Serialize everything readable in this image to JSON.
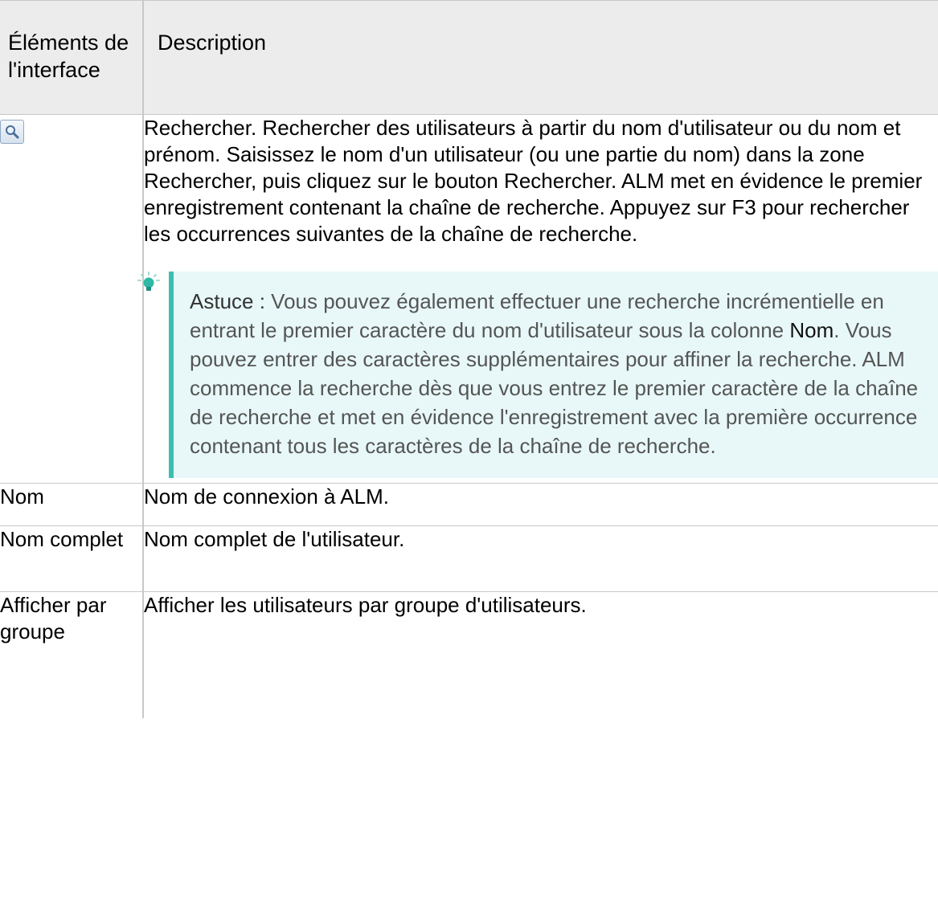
{
  "table": {
    "header": {
      "col1": "Éléments de l'interface",
      "col2": "Description"
    },
    "search_row": {
      "icon": "magnifier-icon",
      "term": "Rechercher.",
      "text_1": " Rechercher des utilisateurs à partir du nom d'utilisateur ou du nom et prénom. Saisissez le nom d'un utilisateur (ou une partie du nom) dans la zone ",
      "kw_1": "Rechercher",
      "text_2": ", puis cliquez sur le bouton ",
      "kw_2": "Rechercher",
      "text_3": ". ALM met en évidence le premier enregistrement contenant la chaîne de recherche. Appuyez sur F3 pour rechercher les occurrences suivantes de la chaîne de recherche."
    },
    "tip": {
      "icon": "lightbulb-icon",
      "label": "Astuce :",
      "text_1": " Vous pouvez également effectuer une recherche incrémentielle en entrant le premier caractère du nom d'utilisateur sous la colonne ",
      "kw": "Nom",
      "text_2": ". Vous pouvez entrer des caractères supplémentaires pour affiner la recherche. ALM commence la recherche dès que vous entrez le premier caractère de la chaîne de recherche et met en évidence l'enregistrement avec la première occurrence contenant tous les caractères de la chaîne de recherche."
    },
    "rows": [
      {
        "label": "Nom",
        "description": "Nom de connexion à ALM."
      },
      {
        "label": "Nom complet",
        "description": "Nom complet de l'utilisateur."
      },
      {
        "label": "Afficher par groupe",
        "description": "Afficher les utilisateurs par groupe d'utilisateurs."
      }
    ]
  },
  "colors": {
    "header_bg": "#ececec",
    "tip_bg": "#e8f8f8",
    "tip_accent": "#3cbfae",
    "border": "#c8c8c8"
  }
}
